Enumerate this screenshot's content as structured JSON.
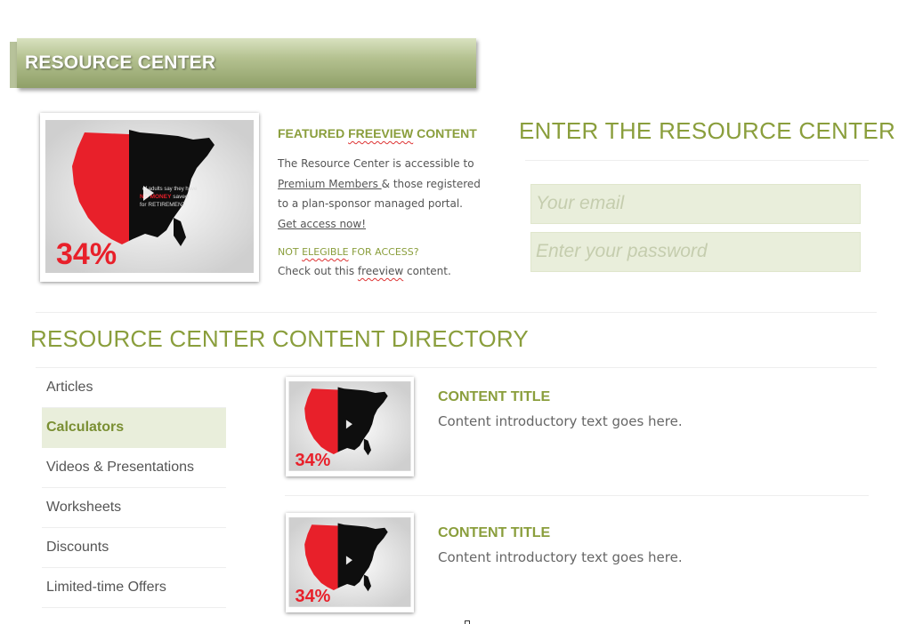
{
  "header": {
    "title": "RESOURCE CENTER"
  },
  "featured": {
    "heading_pre": "FEATURED ",
    "heading_squiggle": "FREEVIEW",
    "heading_post": " CONTENT",
    "body_line1": "The Resource Center is accessible to",
    "premium_link": "Premium Members ",
    "body_line2_rest": "& those registered",
    "body_line3": "to a plan-sponsor managed portal.",
    "access_link": "Get access now!",
    "not_eligible_pre": "NOT ",
    "not_eligible_squiggle": "ELEGIBLE",
    "not_eligible_post": " FOR ACCESS?",
    "check_out_pre": "Check out this  ",
    "check_out_squiggle": "freeview",
    "check_out_post": " content.",
    "thumb": {
      "percent": "34%",
      "text_line1": "of adults say they have",
      "text_line2a": "NO ",
      "text_line2b": "MONEY",
      "text_line2c": " saved",
      "text_line3": "for RETIREMENT"
    }
  },
  "login": {
    "title": "ENTER THE RESOURCE CENTER",
    "email_placeholder": "Your email",
    "password_placeholder": "Enter your password"
  },
  "directory": {
    "title": "RESOURCE CENTER CONTENT DIRECTORY",
    "sidebar": [
      {
        "label": "Articles",
        "active": false
      },
      {
        "label": "Calculators",
        "active": true
      },
      {
        "label": "Videos & Presentations",
        "active": false
      },
      {
        "label": "Worksheets",
        "active": false
      },
      {
        "label": "Discounts",
        "active": false
      },
      {
        "label": "Limited-time Offers",
        "active": false
      }
    ],
    "items": [
      {
        "title": "CONTENT TITLE",
        "text": "Content introductory text goes here."
      },
      {
        "title": "CONTENT TITLE",
        "text": "Content introductory text goes here."
      }
    ]
  },
  "colors": {
    "accent": "#8a9e3c",
    "banner_dark": "#8fa068",
    "field_bg": "#e9eedb",
    "map_red": "#e8202a"
  }
}
